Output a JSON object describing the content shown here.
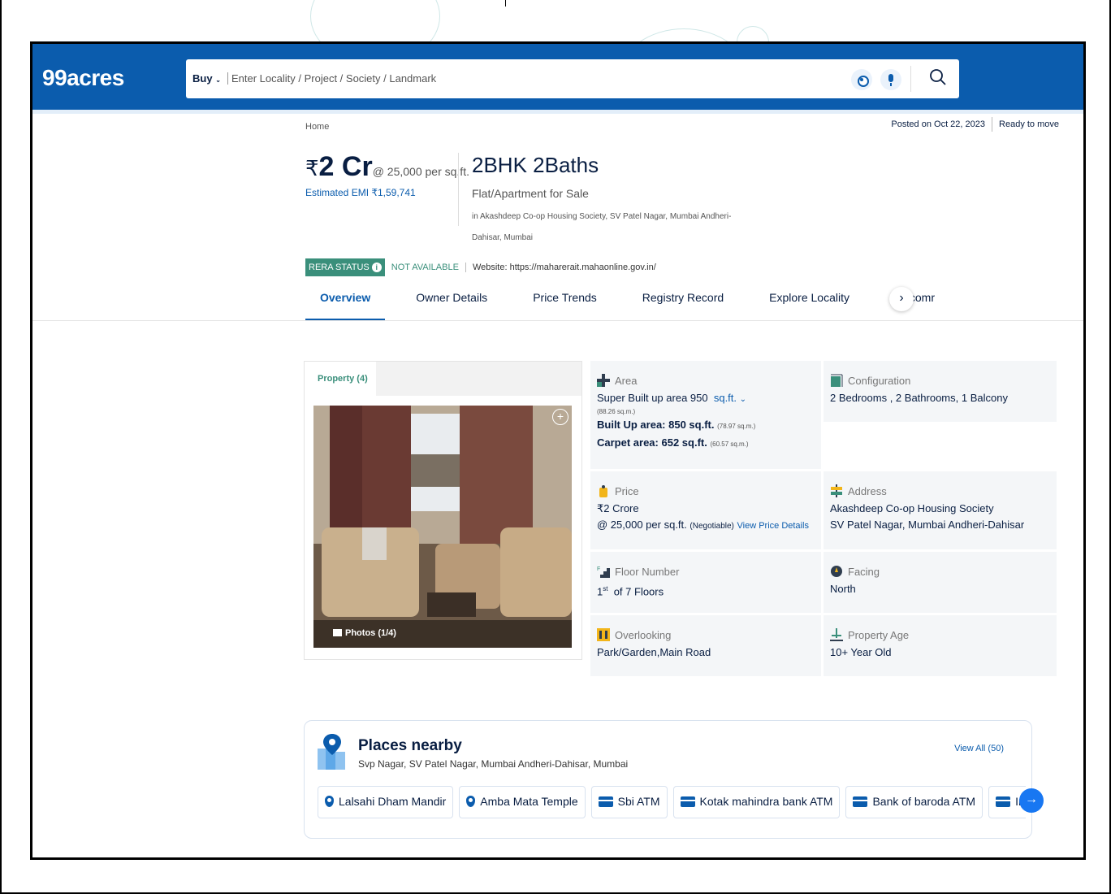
{
  "header": {
    "logo": "99acres",
    "buy_label": "Buy",
    "search_placeholder": "Enter Locality / Project / Society / Landmark"
  },
  "meta": {
    "breadcrumb": "Home",
    "posted_on": "Posted on Oct 22, 2023",
    "status": "Ready to move"
  },
  "price": {
    "rupee": "₹",
    "amount": "2 Cr",
    "rate": "@ 25,000 per sq.ft.",
    "emi": "Estimated EMI ₹1,59,741"
  },
  "property": {
    "title": "2BHK 2Baths",
    "type": "Flat/Apartment for Sale",
    "location": "in Akashdeep Co-op Housing Society, SV Patel Nagar, Mumbai Andheri-Dahisar, Mumbai"
  },
  "rera": {
    "label": "RERA STATUS",
    "value": "NOT AVAILABLE",
    "website": "Website: https://maharerait.mahaonline.gov.in/"
  },
  "tabs": [
    {
      "label": "Overview"
    },
    {
      "label": "Owner Details"
    },
    {
      "label": "Price Trends"
    },
    {
      "label": "Registry Record"
    },
    {
      "label": "Explore Locality"
    },
    {
      "label": "Recomr"
    }
  ],
  "gallery": {
    "tab_label": "Property (4)",
    "photos_label": "Photos (1/4)"
  },
  "details": {
    "area": {
      "label": "Area",
      "super": "Super Built up area 950",
      "unit": "sq.ft.",
      "super_sqm": "(88.26 sq.m.)",
      "built": "Built Up area: 850 sq.ft.",
      "built_sqm": "(78.97 sq.m.)",
      "carpet": "Carpet area: 652 sq.ft.",
      "carpet_sqm": "(60.57 sq.m.)"
    },
    "configuration": {
      "label": "Configuration",
      "value": "2 Bedrooms , 2 Bathrooms, 1 Balcony"
    },
    "price": {
      "label": "Price",
      "value": "₹2 Crore",
      "rate": "@ 25,000 per sq.ft.",
      "negotiable": "(Negotiable)",
      "link": "View Price Details"
    },
    "address": {
      "label": "Address",
      "line1": "Akashdeep Co-op Housing Society",
      "line2": "SV Patel Nagar, Mumbai Andheri-Dahisar"
    },
    "floor": {
      "label": "Floor Number",
      "floor": "1",
      "suffix": "st",
      "rest": "of 7 Floors"
    },
    "facing": {
      "label": "Facing",
      "value": "North"
    },
    "overlooking": {
      "label": "Overlooking",
      "value": "Park/Garden,Main Road"
    },
    "age": {
      "label": "Property Age",
      "value": "10+ Year Old"
    }
  },
  "places": {
    "title": "Places nearby",
    "subtitle": "Svp Nagar, SV Patel Nagar, Mumbai Andheri-Dahisar, Mumbai",
    "view_all": "View All (50)",
    "items": [
      {
        "label": "Lalsahi Dham Mandir",
        "icon": "pin-icon"
      },
      {
        "label": "Amba Mata Temple",
        "icon": "pin-icon"
      },
      {
        "label": "Sbi ATM",
        "icon": "atm-icon"
      },
      {
        "label": "Kotak mahindra bank ATM",
        "icon": "atm-icon"
      },
      {
        "label": "Bank of baroda ATM",
        "icon": "atm-icon"
      },
      {
        "label": "Indusi",
        "icon": "atm-icon"
      }
    ]
  },
  "colors": {
    "brand": "#0B5CAD",
    "rera": "#3a8f7b",
    "chip_next": "#1877f2"
  }
}
